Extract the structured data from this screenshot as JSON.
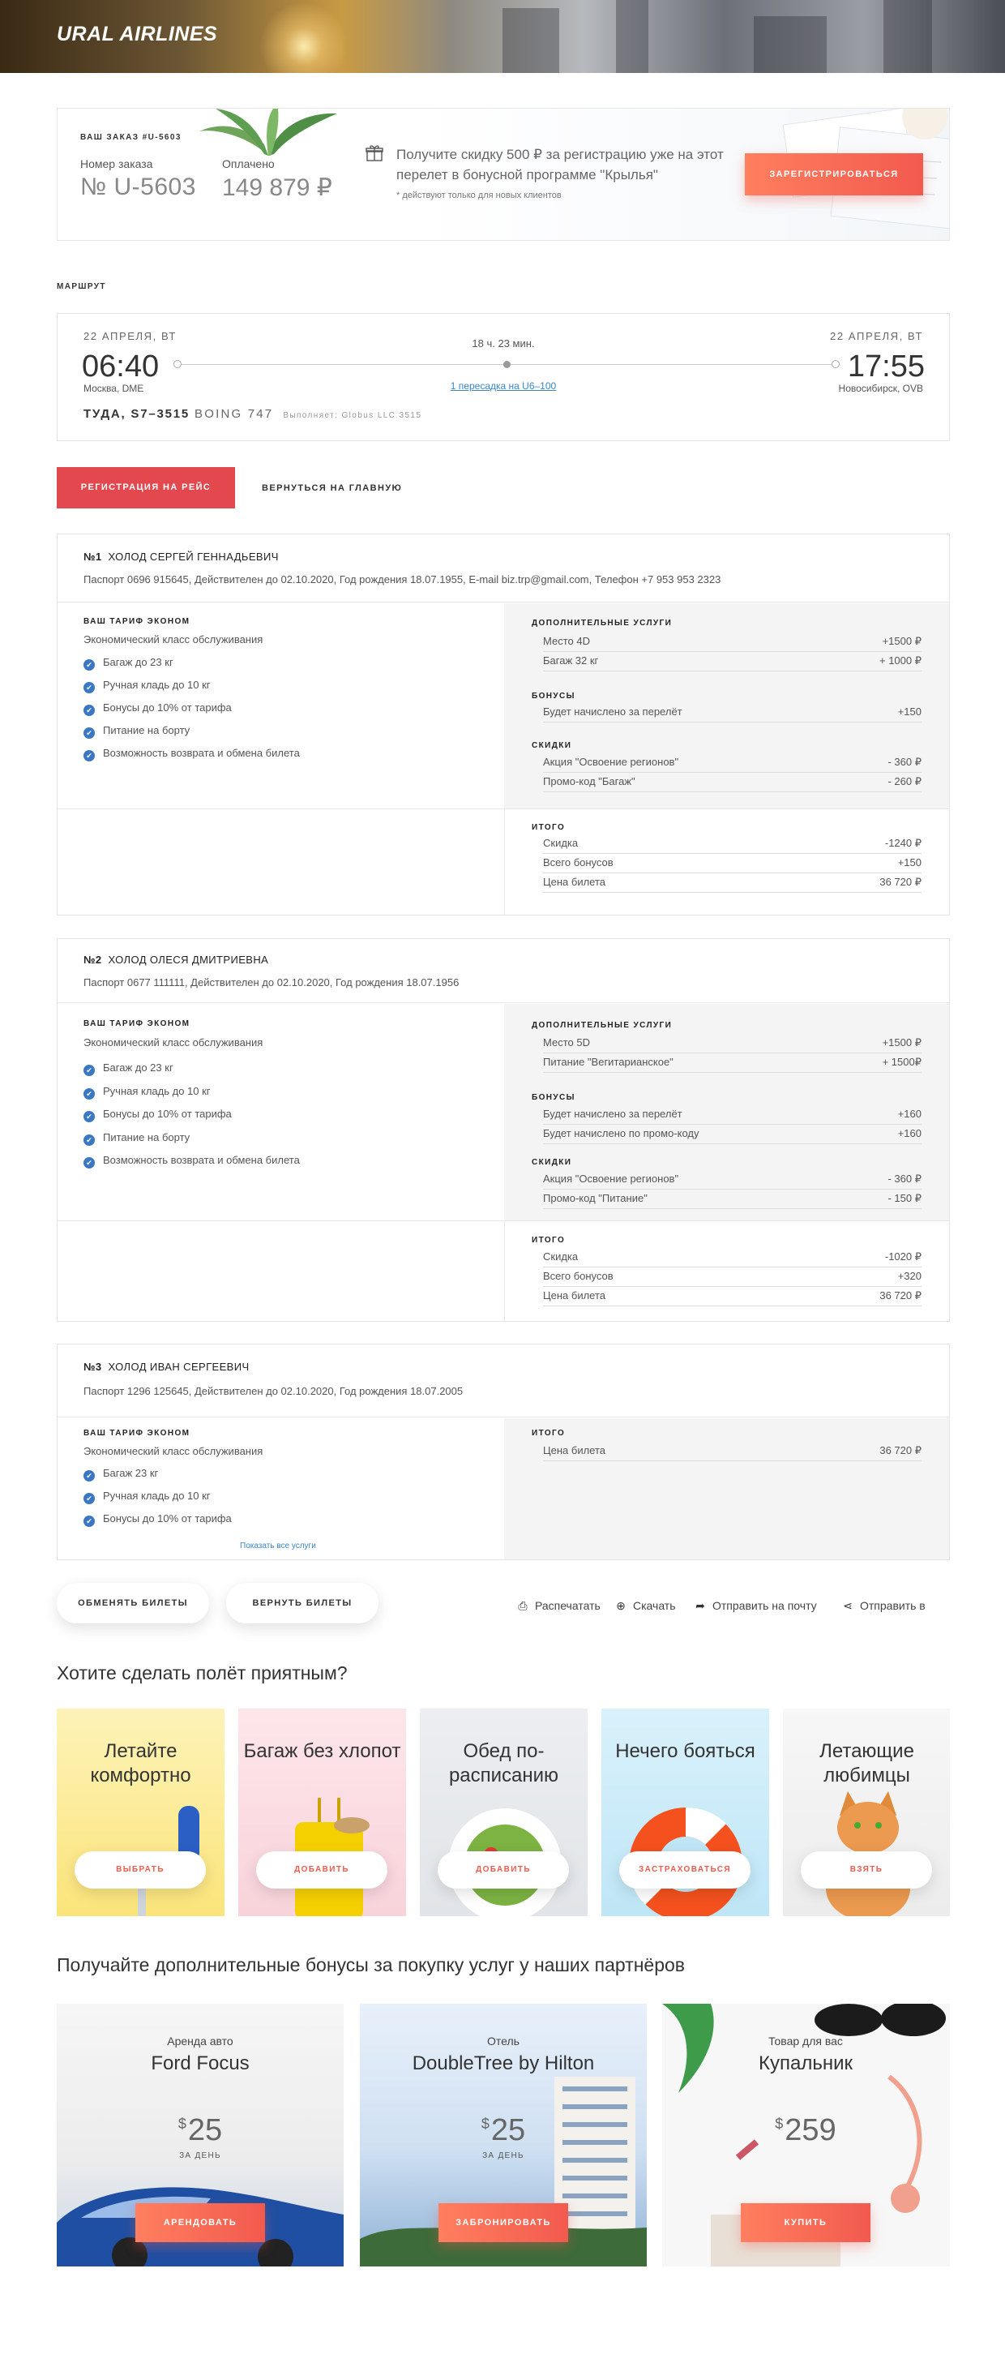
{
  "header": {
    "logo": "URAL AIRLINES"
  },
  "order": {
    "caption": "ВАШ ЗАКАЗ #U-5603",
    "number_label": "Номер заказа",
    "number": "№ U-5603",
    "paid_label": "Оплачено",
    "paid": "149 879 ₽",
    "promo": "Получите скидку 500 ₽ за регистрацию уже на этот перелет в бонусной программе \"Крылья\"",
    "promo_note": "* действуют только для новых клиентов",
    "register_button": "ЗАРЕГИСТРИРОВАТЬСЯ"
  },
  "route": {
    "title": "МАРШРУТ",
    "dep_date": "22 АПРЕЛЯ, ВТ",
    "dep_time": "06:40",
    "dep_place": "Москва, DME",
    "arr_date": "22 АПРЕЛЯ, ВТ",
    "arr_time": "17:55",
    "arr_place": "Новосибирск, OVB",
    "duration": "18 ч. 23 мин.",
    "transfer": "1 пересадка на U6–100",
    "flight": "ТУДА, S7–3515",
    "plane": "BOING 747",
    "operator": "Выполняет: Globus LLC 3515"
  },
  "actions": {
    "checkin": "РЕГИСТРАЦИЯ НА РЕЙС",
    "home": "ВЕРНУТЬСЯ НА ГЛАВНУЮ"
  },
  "labels": {
    "tariff": "ВАШ ТАРИФ ЭКОНОМ",
    "tariff_class": "Экономический класс обслуживания",
    "extras": "ДОПОЛНИТЕЛЬНЫЕ УСЛУГИ",
    "bonuses": "БОНУСЫ",
    "discounts": "СКИДКИ",
    "total": "ИТОГО",
    "show_all": "Показать все услуги"
  },
  "passengers": [
    {
      "num": "№1",
      "name": "ХОЛОД СЕРГЕЙ ГЕННАДЬЕВИЧ",
      "passport": "Паспорт 0696 915645, Действителен до 02.10.2020, Год рождения 18.07.1955, E-mail biz.trp@gmail.com, Телефон +7 953 953 2323",
      "features": [
        "Багаж до 23 кг",
        "Ручная кладь до 10 кг",
        "Бонусы до 10% от тарифа",
        "Питание на борту",
        "Возможность возврата и обмена билета"
      ],
      "extras": [
        {
          "k": "Место 4D",
          "v": "+1500 ₽"
        },
        {
          "k": "Багаж 32 кг",
          "v": "+ 1000 ₽"
        }
      ],
      "bonuses": [
        {
          "k": "Будет начислено за перелёт",
          "v": "+150"
        }
      ],
      "discounts": [
        {
          "k": "Акция \"Освоение регионов\"",
          "v": "- 360 ₽"
        },
        {
          "k": "Промо-код \"Багаж\"",
          "v": "- 260 ₽"
        }
      ],
      "totals": [
        {
          "k": "Скидка",
          "v": "-1240 ₽"
        },
        {
          "k": "Всего бонусов",
          "v": "+150"
        },
        {
          "k": "Цена билета",
          "v": "36 720 ₽"
        }
      ]
    },
    {
      "num": "№2",
      "name": "ХОЛОД ОЛЕСЯ ДМИТРИЕВНА",
      "passport": "Паспорт 0677 111111, Действителен до 02.10.2020, Год рождения 18.07.1956",
      "features": [
        "Багаж до 23 кг",
        "Ручная кладь до 10 кг",
        "Бонусы до 10% от тарифа",
        "Питание на борту",
        "Возможность возврата и обмена билета"
      ],
      "extras": [
        {
          "k": "Место 5D",
          "v": "+1500 ₽"
        },
        {
          "k": "Питание \"Вегитарианское\"",
          "v": "+ 1500₽"
        }
      ],
      "bonuses": [
        {
          "k": "Будет начислено за перелёт",
          "v": "+160"
        },
        {
          "k": "Будет начислено по промо-коду",
          "v": "+160"
        }
      ],
      "discounts": [
        {
          "k": "Акция \"Освоение регионов\"",
          "v": "- 360 ₽"
        },
        {
          "k": "Промо-код \"Питание\"",
          "v": "- 150 ₽"
        }
      ],
      "totals": [
        {
          "k": "Скидка",
          "v": "-1020 ₽"
        },
        {
          "k": "Всего бонусов",
          "v": "+320"
        },
        {
          "k": "Цена билета",
          "v": "36 720 ₽"
        }
      ]
    },
    {
      "num": "№3",
      "name": "ХОЛОД ИВАН СЕРГЕЕВИЧ",
      "passport": "Паспорт 1296 125645, Действителен до 02.10.2020, Год рождения 18.07.2005",
      "features": [
        "Багаж 23 кг",
        "Ручная кладь до 10 кг",
        "Бонусы до 10% от тарифа"
      ],
      "totals": [
        {
          "k": "Цена билета",
          "v": "36 720 ₽"
        }
      ]
    }
  ],
  "bottom": {
    "exchange": "ОБМЕНЯТЬ БИЛЕТЫ",
    "refund": "ВЕРНУТЬ БИЛЕТЫ",
    "print": "Распечатать",
    "download": "Скачать",
    "email": "Отправить на почту",
    "share": "Отправить в"
  },
  "services": {
    "title": "Хотите сделать полёт приятным?",
    "items": [
      {
        "title": "Летайте комфортно",
        "button": "ВЫБРАТЬ"
      },
      {
        "title": "Багаж без хлопот",
        "button": "ДОБАВИТЬ"
      },
      {
        "title": "Обед по-расписанию",
        "button": "ДОБАВИТЬ"
      },
      {
        "title": "Нечего бояться",
        "button": "ЗАСТРАХОВАТЬСЯ"
      },
      {
        "title": "Летающие любимцы",
        "button": "ВЗЯТЬ"
      }
    ]
  },
  "partners": {
    "title": "Получайте дополнительные бонусы за покупку услуг у наших партнёров",
    "items": [
      {
        "category": "Аренда авто",
        "name": "Ford Focus",
        "currency": "$",
        "price": "25",
        "per": "ЗА ДЕНЬ",
        "button": "АРЕНДОВАТЬ"
      },
      {
        "category": "Отель",
        "name": "DoubleTree by Hilton",
        "currency": "$",
        "price": "25",
        "per": "ЗА ДЕНЬ",
        "button": "ЗАБРОНИРОВАТЬ"
      },
      {
        "category": "Товар для вас",
        "name": "Купальник",
        "currency": "$",
        "price": "259",
        "per": "",
        "button": "КУПИТЬ"
      }
    ]
  }
}
